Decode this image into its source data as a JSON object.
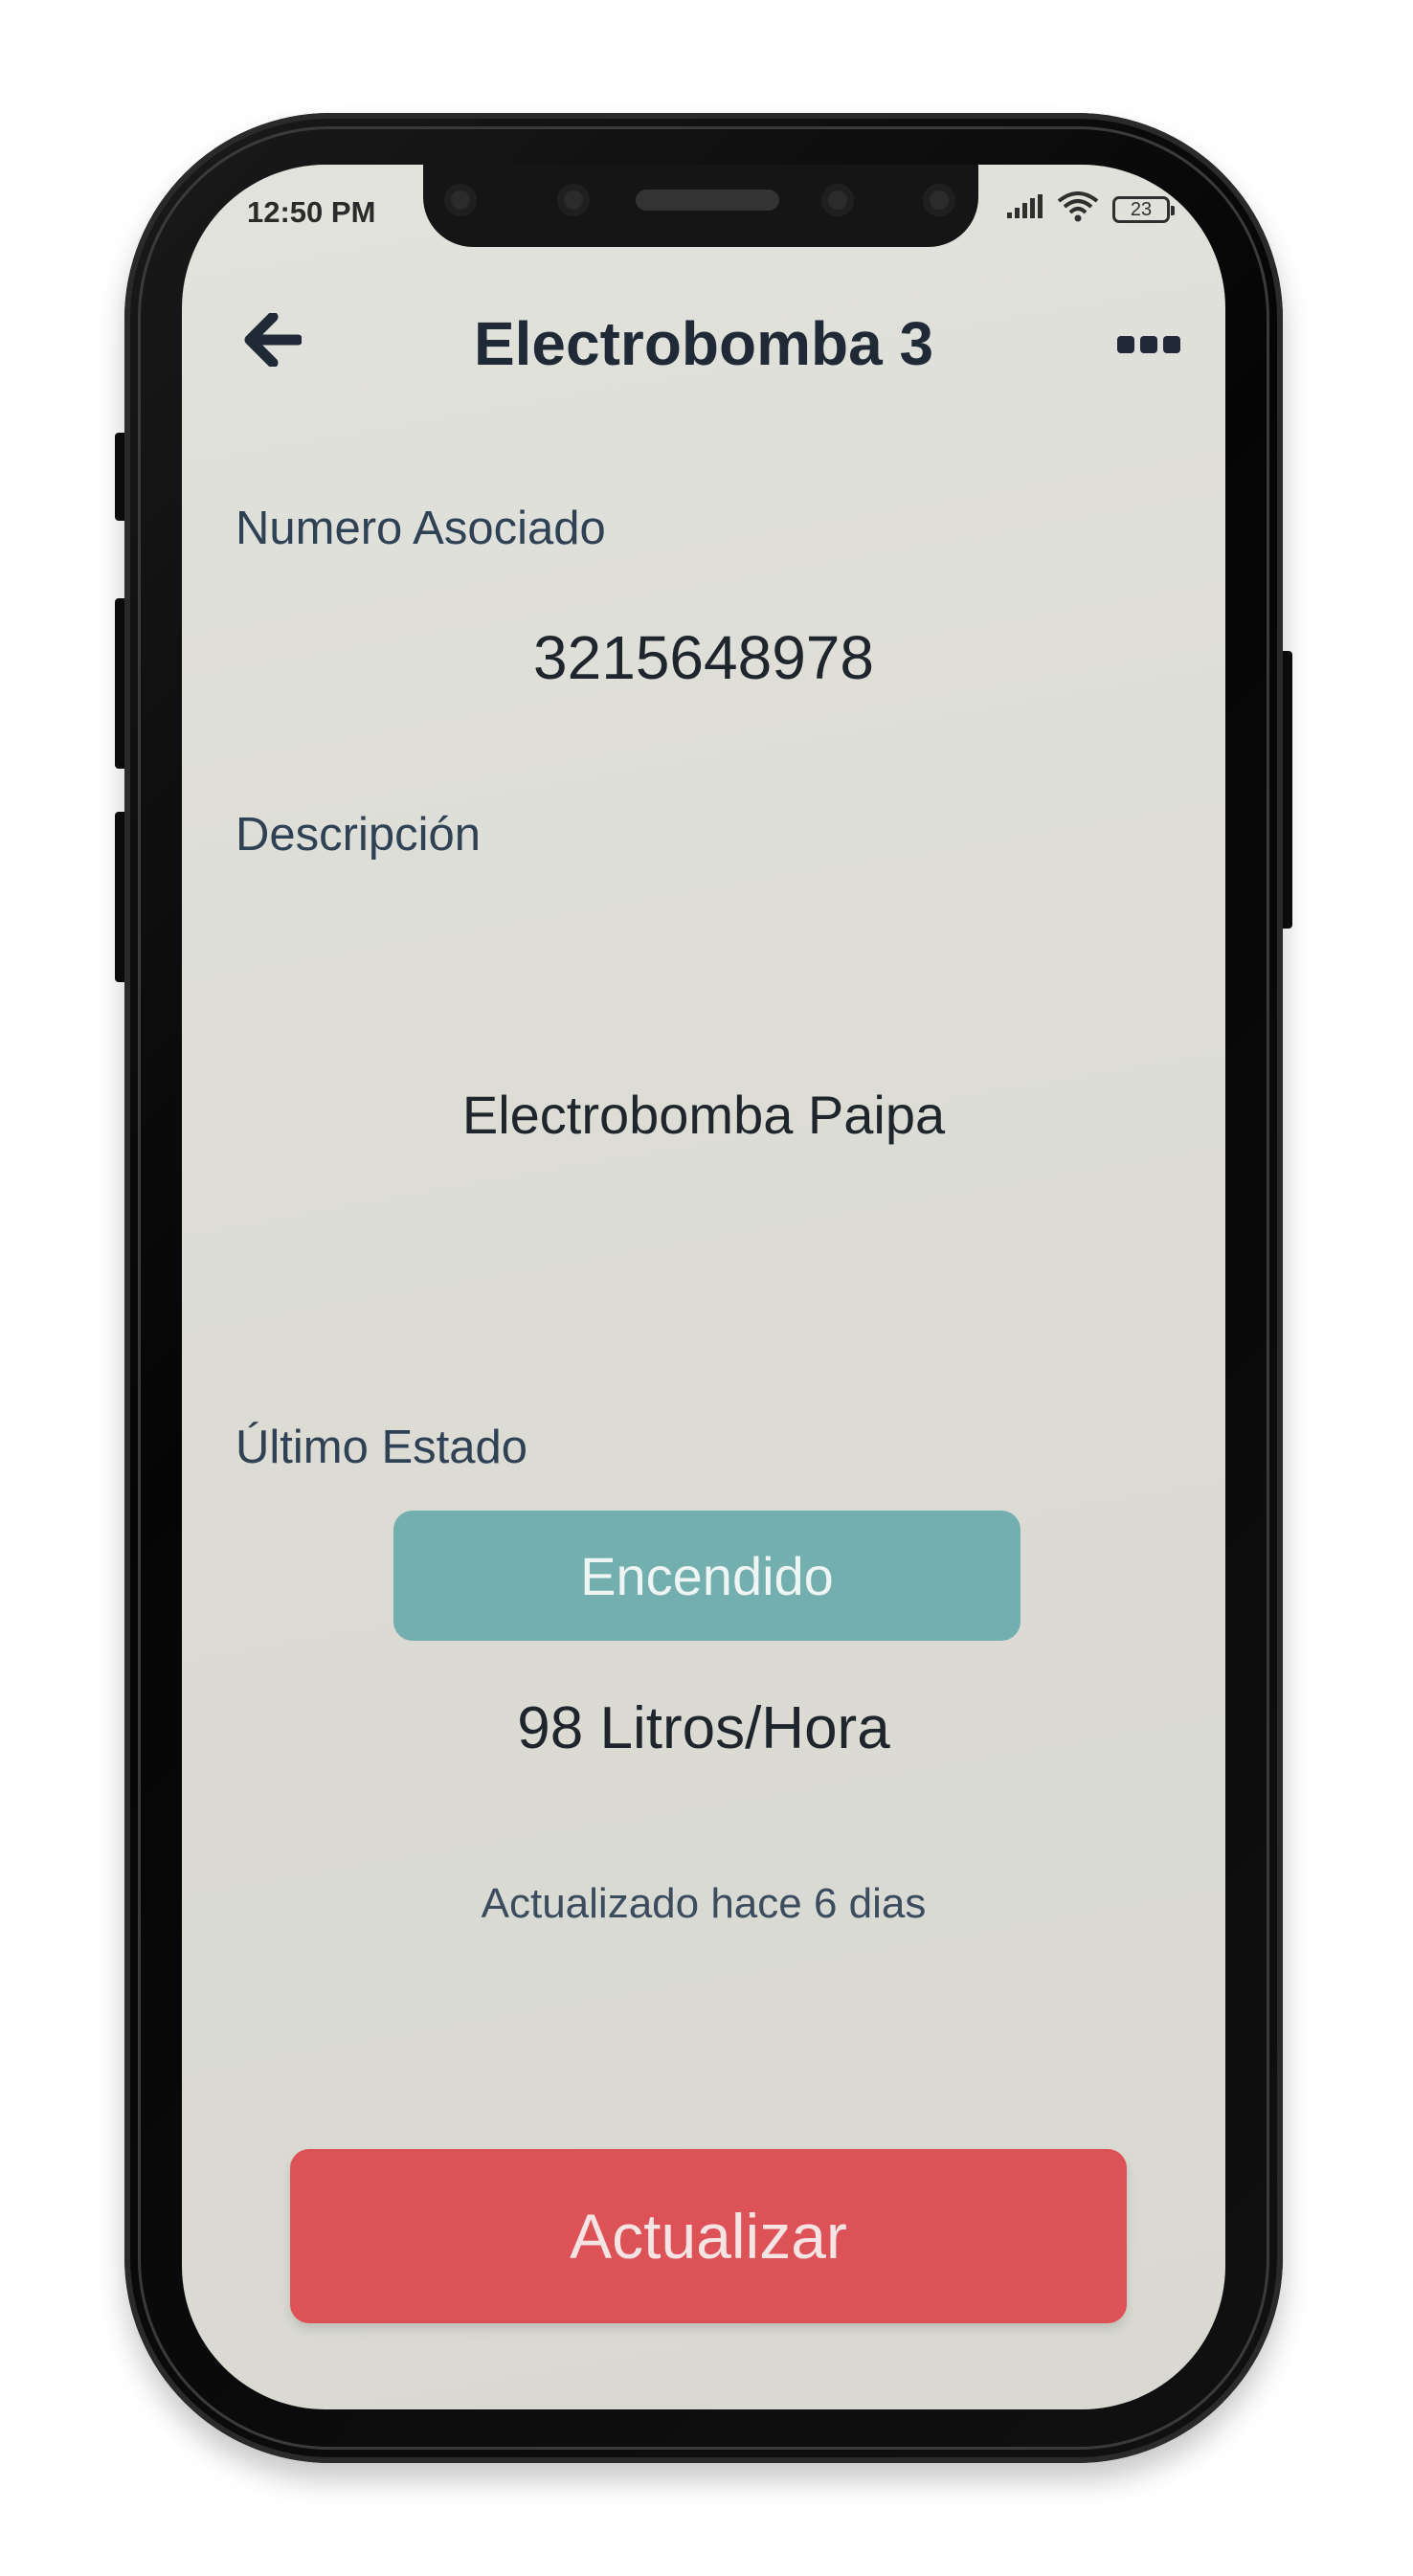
{
  "status_bar": {
    "time": "12:50 PM",
    "battery": "23",
    "icons": [
      "signal-icon",
      "wifi-icon",
      "battery-icon"
    ]
  },
  "header": {
    "title": "Electrobomba 3",
    "back_icon": "arrow-left-icon",
    "more_icon": "more-dots-icon"
  },
  "fields": {
    "numero_label": "Numero Asociado",
    "numero_value": "3215648978",
    "descripcion_label": "Descripción",
    "descripcion_value": "Electrobomba Paipa",
    "estado_label": "Último Estado",
    "estado_value": "Encendido",
    "flow_value": "98 Litros/Hora",
    "updated_text": "Actualizado hace 6 dias"
  },
  "actions": {
    "update_label": "Actualizar"
  },
  "colors": {
    "status_pill": "#72afae",
    "update_button": "#dd5257",
    "title_text": "#1f2a36",
    "label_text": "#2f4154",
    "screen_bg": "#deded8"
  }
}
